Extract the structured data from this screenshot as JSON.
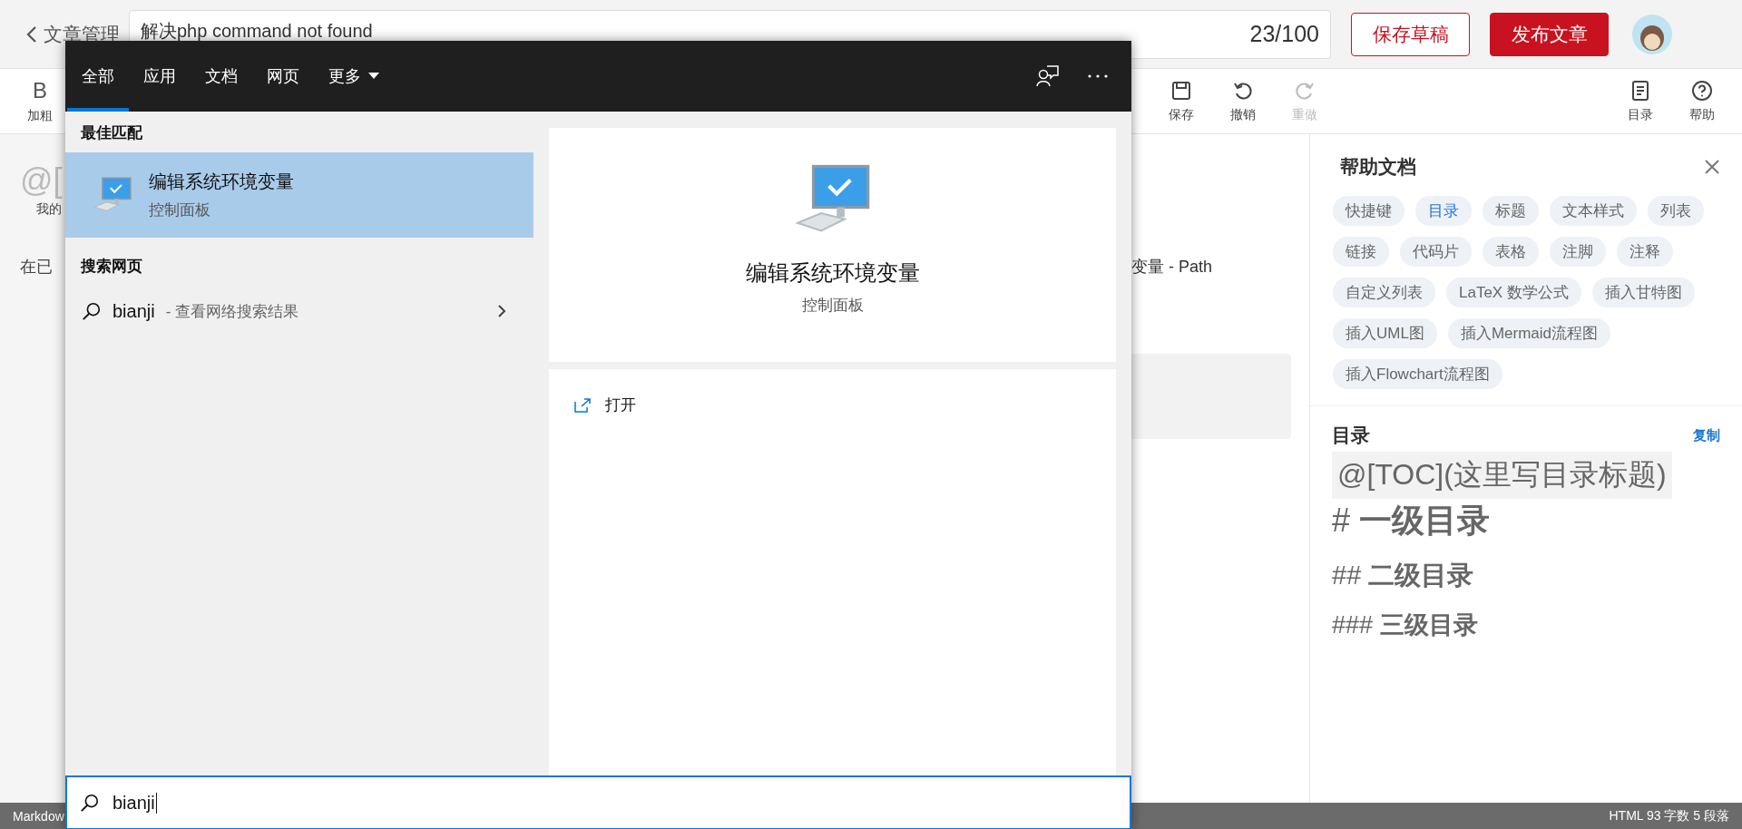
{
  "header": {
    "back_label": "文章管理",
    "title_value": "解决php command not found",
    "title_count": "23/100",
    "buttons": [
      {
        "label": "保存草稿",
        "kind": "outline"
      },
      {
        "label": "发布文章",
        "kind": "primary"
      }
    ]
  },
  "toolbar": {
    "left": [
      {
        "glyph": "B",
        "label": "加粗"
      }
    ],
    "right": [
      {
        "kind": "save",
        "label": "保存",
        "disabled": false
      },
      {
        "kind": "undo",
        "label": "撤销",
        "disabled": false
      },
      {
        "kind": "redo",
        "label": "重做",
        "disabled": true
      }
    ],
    "far_right": [
      {
        "kind": "toc",
        "label": "目录"
      },
      {
        "kind": "help",
        "label": "帮助"
      }
    ]
  },
  "editor": {
    "source_fragments": [
      {
        "kind": "big",
        "text": "@["
      },
      {
        "kind": "small",
        "text": "我的"
      },
      {
        "kind": "normal",
        "text": "在已"
      }
    ],
    "preview_fragment": "变量 - Path"
  },
  "help_panel": {
    "title": "帮助文档",
    "tags": [
      {
        "label": "快捷键",
        "selected": false
      },
      {
        "label": "目录",
        "selected": true
      },
      {
        "label": "标题",
        "selected": false
      },
      {
        "label": "文本样式",
        "selected": false
      },
      {
        "label": "列表",
        "selected": false
      },
      {
        "label": "链接",
        "selected": false
      },
      {
        "label": "代码片",
        "selected": false
      },
      {
        "label": "表格",
        "selected": false
      },
      {
        "label": "注脚",
        "selected": false
      },
      {
        "label": "注释",
        "selected": false
      },
      {
        "label": "自定义列表",
        "selected": false
      },
      {
        "label": "LaTeX 数学公式",
        "selected": false
      },
      {
        "label": "插入甘特图",
        "selected": false
      },
      {
        "label": "插入UML图",
        "selected": false
      },
      {
        "label": "插入Mermaid流程图",
        "selected": false
      },
      {
        "label": "插入Flowchart流程图",
        "selected": false
      }
    ],
    "toc": {
      "title": "目录",
      "copy_link": "复制",
      "code": "@[TOC](这里写目录标题)",
      "lines": [
        {
          "kind": "h1",
          "text": "# **一级目录**"
        },
        {
          "kind": "h2",
          "text": "## **二级目录**"
        },
        {
          "kind": "h3",
          "text": "### **三级目录**"
        }
      ]
    }
  },
  "status_bar": {
    "left": "Markdow",
    "right": "HTML 93 字数 5 段落"
  },
  "search_popup": {
    "tabs": [
      {
        "label": "全部",
        "selected": true,
        "dropdown": false
      },
      {
        "label": "应用",
        "selected": false,
        "dropdown": false
      },
      {
        "label": "文档",
        "selected": false,
        "dropdown": false
      },
      {
        "label": "网页",
        "selected": false,
        "dropdown": false
      },
      {
        "label": "更多",
        "selected": false,
        "dropdown": true
      }
    ],
    "best_match_heading": "最佳匹配",
    "best_match": {
      "title": "编辑系统环境变量",
      "subtitle": "控制面板",
      "selected": true
    },
    "web_heading": "搜索网页",
    "web_result": {
      "query": "bianji",
      "suffix": "- 查看网络搜索结果"
    },
    "preview": {
      "title": "编辑系统环境变量",
      "subtitle": "控制面板",
      "actions": [
        "打开"
      ]
    },
    "query": "bianji"
  }
}
